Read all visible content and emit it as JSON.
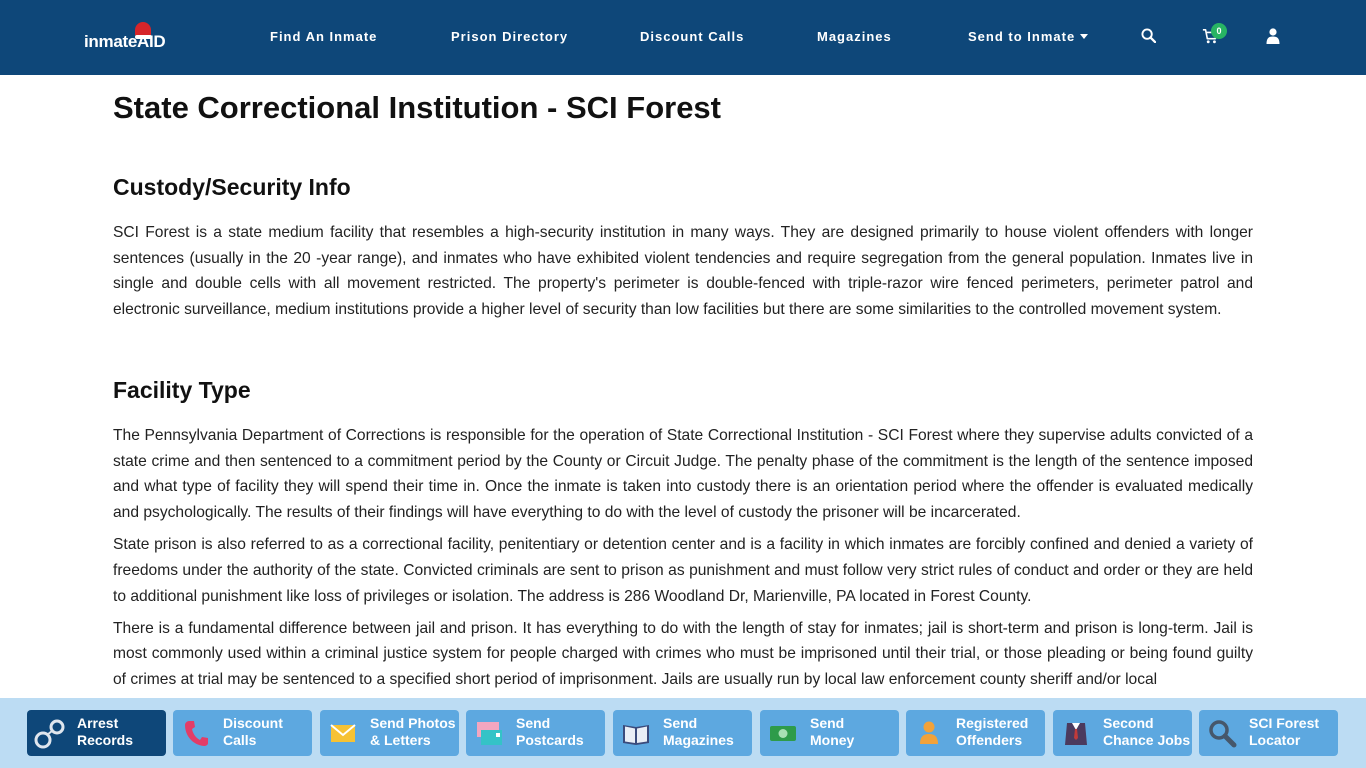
{
  "brand": {
    "logo_text": "inmateAID"
  },
  "nav": {
    "links": [
      "Find An Inmate",
      "Prison Directory",
      "Discount Calls",
      "Magazines",
      "Send to Inmate"
    ],
    "cart_count": "0",
    "icons": [
      "search-icon",
      "cart-icon",
      "user-icon"
    ]
  },
  "main": {
    "title": "State Correctional Institution - SCI Forest",
    "sections": [
      {
        "heading": "Custody/Security Info",
        "paragraphs": [
          "SCI Forest is a state medium facility that resembles a high-security institution in many ways. They are designed primarily to house violent offenders with longer sentences (usually in the 20 -year range), and inmates who have exhibited violent tendencies and require segregation from the general population. Inmates live in single and double cells with all movement restricted. The property's perimeter is double-fenced with triple-razor wire fenced perimeters, perimeter patrol and electronic surveillance, medium institutions provide a higher level of security than low facilities but there are some similarities to the controlled movement system."
        ]
      },
      {
        "heading": "Facility Type",
        "paragraphs": [
          "The Pennsylvania Department of Corrections is responsible for the operation of State Correctional Institution - SCI Forest where they supervise adults convicted of a state crime and then sentenced to a commitment period by the County or Circuit Judge. The penalty phase of the commitment is the length of the sentence imposed and what type of facility they will spend their time in. Once the inmate is taken into custody there is an orientation period where the offender is evaluated medically and psychologically. The results of their findings will have everything to do with the level of custody the prisoner will be incarcerated.",
          "State prison is also referred to as a correctional facility, penitentiary or detention center and is a facility in which inmates are forcibly confined and denied a variety of freedoms under the authority of the state. Convicted criminals are sent to prison as punishment and must follow very strict rules of conduct and order or they are held to additional punishment like loss of privileges or isolation. The address is 286 Woodland Dr, Marienville, PA located in Forest County.",
          "There is a fundamental difference between jail and prison. It has everything to do with the length of stay for inmates; jail is short-term and prison is long-term. Jail is most commonly used within a criminal justice system for people charged with crimes who must be imprisoned until their trial, or those pleading or being found guilty of crimes at trial may be sentenced to a specified short period of imprisonment. Jails are usually run by local law enforcement county sheriff and/or local"
        ]
      }
    ]
  },
  "bottom_bar": {
    "tiles": [
      {
        "label": "Arrest\nRecords",
        "icon": "handcuffs-icon"
      },
      {
        "label": "Discount\nCalls",
        "icon": "phone-icon"
      },
      {
        "label": "Send Photos\n& Letters",
        "icon": "envelope-icon"
      },
      {
        "label": "Send\nPostcards",
        "icon": "postcard-icon"
      },
      {
        "label": "Send\nMagazines",
        "icon": "book-icon"
      },
      {
        "label": "Send\nMoney",
        "icon": "money-icon"
      },
      {
        "label": "Registered\nOffenders",
        "icon": "person-icon"
      },
      {
        "label": "Second\nChance Jobs",
        "icon": "suit-icon"
      },
      {
        "label": "SCI Forest\nLocator",
        "icon": "magnifier-icon"
      }
    ]
  },
  "colors": {
    "nav_bg": "#0e4779",
    "bottom_bar_bg": "#bcdcf3",
    "tile_bg": "#5da8e0",
    "tile_active_bg": "#0e4779",
    "badge": "#28b463"
  }
}
